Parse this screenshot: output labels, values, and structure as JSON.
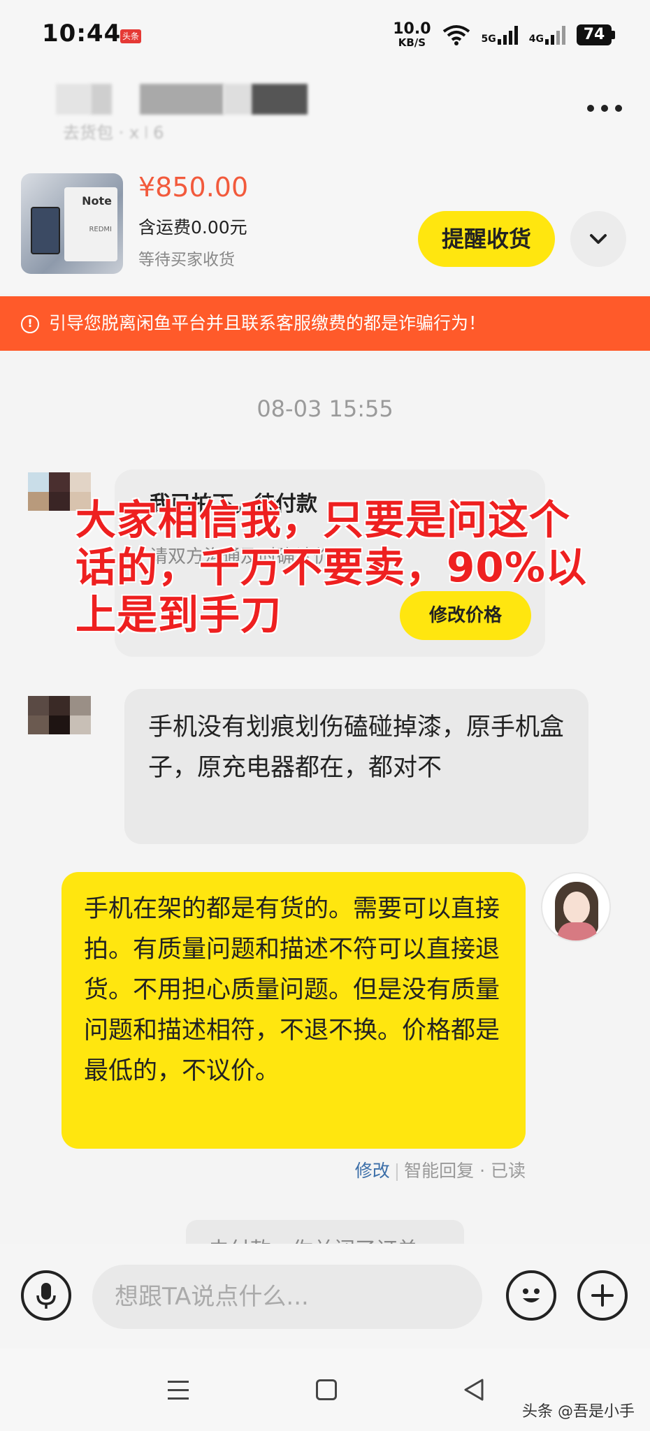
{
  "status_bar": {
    "time": "10:44",
    "app_badge": "头条",
    "net_speed": "10.0",
    "net_unit": "KB/S",
    "signal_1": "5G",
    "signal_2": "4G",
    "battery": "74"
  },
  "header": {
    "contact_sub": "去货包 · x ꘡ 6"
  },
  "product": {
    "image_text": "Note",
    "image_brand": "REDMI",
    "price": "¥850.00",
    "shipping": "含运费0.00元",
    "status": "等待买家收货",
    "remind_label": "提醒收货"
  },
  "warning": {
    "text": "引导您脱离闲鱼平台并且联系客服缴费的都是诈骗行为！"
  },
  "chat": {
    "timestamp": "08-03 15:55",
    "order_card": {
      "title": "我已拍下，待付款",
      "subtitle": "请双方沟通及时确认价格",
      "button": "修改价格"
    },
    "overlay_annotation": "大家相信我，只要是问这个话的，千万不要卖，90%以上是到手刀",
    "buyer_message": "手机没有划痕划伤磕碰掉漆，原手机盒子，原充电器都在，都对不",
    "seller_message": "手机在架的都是有货的。需要可以直接拍。有质量问题和描述不符可以直接退货。不用担心质量问题。但是没有质量问题和描述相符，不退不换。价格都是最低的，不议价。",
    "meta_edit": "修改",
    "meta_status": "智能回复 · 已读",
    "clipped_notice": "未付款，你关闭了订单"
  },
  "input_bar": {
    "placeholder": "想跟TA说点什么..."
  },
  "watermark": "头条 @吾是小手",
  "colors": {
    "accent_yellow": "#ffe60f",
    "price_orange": "#f25a3c",
    "warning_bg": "#ff5a2a",
    "overlay_red": "#ee2020"
  },
  "icons": [
    "mic-icon",
    "emoji-icon",
    "plus-icon",
    "more-icon",
    "chevron-down-icon",
    "warning-icon",
    "nav-menu-icon",
    "nav-home-icon",
    "nav-back-icon"
  ]
}
